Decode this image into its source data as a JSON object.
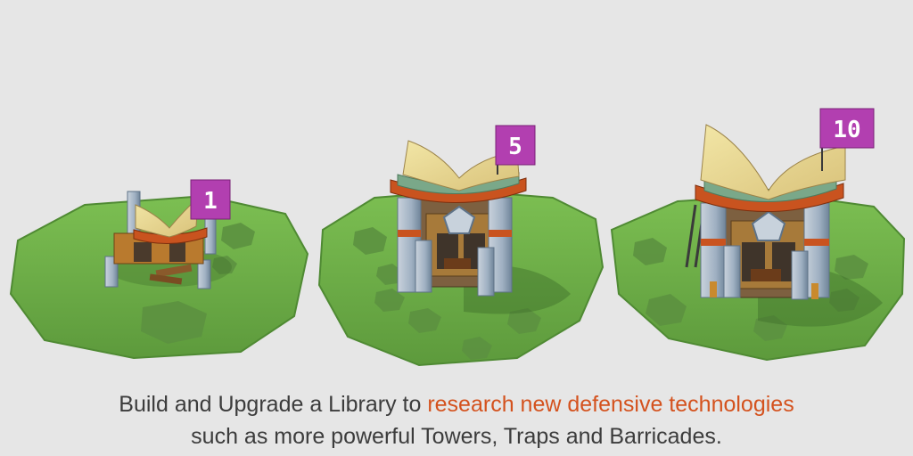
{
  "levels": [
    {
      "label": "1",
      "badge_color": "#b23fb0"
    },
    {
      "label": "5",
      "badge_color": "#b23fb0"
    },
    {
      "label": "10",
      "badge_color": "#b23fb0"
    }
  ],
  "caption": {
    "line1_prefix": "Build and Upgrade a Library to ",
    "line1_highlight": "research new defensive technologies",
    "line2": "such as more powerful Towers, Traps and Barricades."
  },
  "colors": {
    "background": "#e6e6e6",
    "grass": "#6fb04a",
    "highlight_text": "#d4521e",
    "body_text": "#3c3c3c"
  }
}
